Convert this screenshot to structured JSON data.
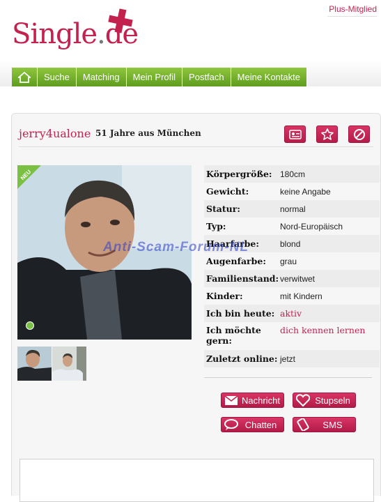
{
  "header": {
    "plus_link": "Plus-Mitglied",
    "logo_main": "Single",
    "logo_dot": ".",
    "logo_tld": "de",
    "logo_color": "#c3224f"
  },
  "nav": {
    "home_icon": "home-icon",
    "items": [
      {
        "label": "Suche"
      },
      {
        "label": "Matching"
      },
      {
        "label": "Mein Profil"
      },
      {
        "label": "Postfach"
      },
      {
        "label": "Meine Kontakte"
      }
    ],
    "color": "#6faf2a"
  },
  "profile": {
    "username": "jerry4ualone",
    "age_city": "51 Jahre aus München",
    "actions": [
      "contact-card-icon",
      "star-icon",
      "block-icon"
    ],
    "badge": "NEU",
    "details": [
      {
        "label": "Körpergröße:",
        "value": "180cm"
      },
      {
        "label": "Gewicht:",
        "value": "keine Angabe"
      },
      {
        "label": "Statur:",
        "value": "normal"
      },
      {
        "label": "Typ:",
        "value": "Nord-Europäisch"
      },
      {
        "label": "Haarfarbe:",
        "value": "blond"
      },
      {
        "label": "Augenfarbe:",
        "value": "grau"
      },
      {
        "label": "Familienstand:",
        "value": "verwitwet"
      },
      {
        "label": "Kinder:",
        "value": "mit Kindern"
      },
      {
        "label": "Ich bin heute:",
        "value": "aktiv"
      },
      {
        "label": "Ich möchte gern:",
        "value": "dich kennen lernen"
      },
      {
        "label": "Zuletzt online:",
        "value": "jetzt"
      }
    ],
    "contact_buttons": [
      {
        "label": "Nachricht",
        "icon": "envelope-icon"
      },
      {
        "label": "Stupseln",
        "icon": "heart-icon"
      },
      {
        "label": "Chatten",
        "icon": "chat-bubble-icon"
      },
      {
        "label": "SMS",
        "icon": "phone-icon"
      }
    ]
  },
  "watermark": "Anti-Scam-Forum-NL"
}
